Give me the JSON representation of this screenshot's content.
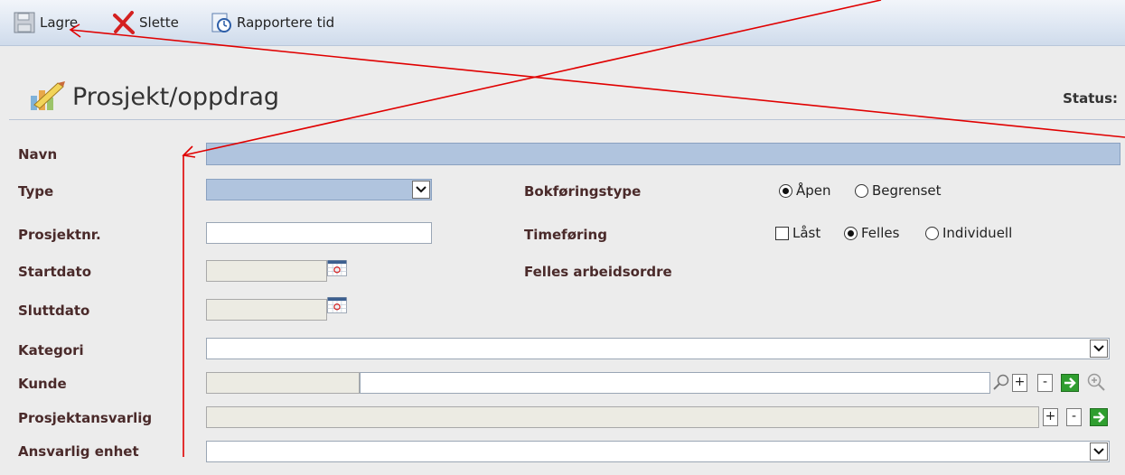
{
  "toolbar": {
    "save_label": "Lagre",
    "delete_label": "Slette",
    "report_time_label": "Rapportere tid"
  },
  "header": {
    "title": "Prosjekt/oppdrag",
    "status_label": "Status:"
  },
  "form": {
    "name_label": "Navn",
    "type_label": "Type",
    "project_number_label": "Prosjektnr.",
    "start_date_label": "Startdato",
    "end_date_label": "Sluttdato",
    "category_label": "Kategori",
    "customer_label": "Kunde",
    "project_manager_label": "Prosjektansvarlig",
    "responsible_unit_label": "Ansvarlig enhet",
    "booking_type_label": "Bokføringstype",
    "booking_type_options": [
      "Åpen",
      "Begrenset"
    ],
    "booking_type_selected": "Åpen",
    "time_entry_label": "Timeføring",
    "time_entry_locked_label": "Låst",
    "time_entry_options": [
      "Felles",
      "Individuell"
    ],
    "time_entry_selected": "Felles",
    "shared_work_order_label": "Felles arbeidsordre",
    "plus_label": "+",
    "minus_label": "-"
  },
  "colors": {
    "required_field": "#b0c4de",
    "disabled_field": "#ecebe3",
    "annotation_line": "#e00000"
  }
}
